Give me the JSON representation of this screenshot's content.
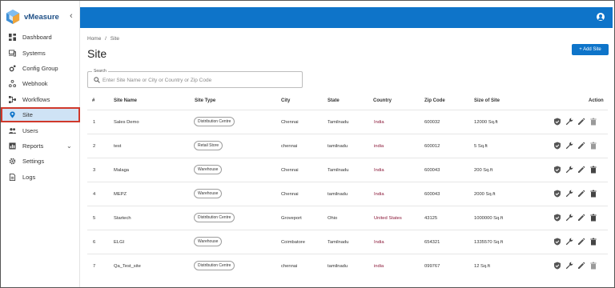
{
  "app": {
    "name": "vMeasure"
  },
  "sidebar": {
    "items": [
      {
        "label": "Dashboard",
        "icon": "dashboard-icon"
      },
      {
        "label": "Systems",
        "icon": "systems-icon"
      },
      {
        "label": "Config Group",
        "icon": "config-group-icon"
      },
      {
        "label": "Webhook",
        "icon": "webhook-icon"
      },
      {
        "label": "Workflows",
        "icon": "workflows-icon"
      },
      {
        "label": "Site",
        "icon": "site-pin-icon",
        "active": true
      },
      {
        "label": "Users",
        "icon": "users-icon"
      },
      {
        "label": "Reports",
        "icon": "reports-icon",
        "expandable": true
      },
      {
        "label": "Settings",
        "icon": "settings-gear-icon"
      },
      {
        "label": "Logs",
        "icon": "logs-icon"
      }
    ]
  },
  "breadcrumb": {
    "home": "Home",
    "separator": "/",
    "current": "Site"
  },
  "page": {
    "title": "Site",
    "add_button": "+ Add Site"
  },
  "search": {
    "legend": "Search",
    "placeholder": "Enter Site Name or City or Country or Zip Code"
  },
  "table": {
    "headers": {
      "num": "#",
      "site_name": "Site Name",
      "site_type": "Site Type",
      "city": "City",
      "state": "State",
      "country": "Country",
      "zip": "Zip Code",
      "size": "Size of Site",
      "action": "Action"
    },
    "rows": [
      {
        "num": "1",
        "site_name": "Sales Demo",
        "site_type": "Distribution Centre",
        "city": "Chennai",
        "state": "Tamilnadu",
        "country": "India",
        "zip": "600032",
        "size": "12000 Sq.ft"
      },
      {
        "num": "2",
        "site_name": "test",
        "site_type": "Retail Store",
        "city": "chennai",
        "state": "tamilnadu",
        "country": "india",
        "zip": "600012",
        "size": "5 Sq.ft"
      },
      {
        "num": "3",
        "site_name": "Malaga",
        "site_type": "Warehouse",
        "city": "Chennai",
        "state": "Tamilnadu",
        "country": "India",
        "zip": "600043",
        "size": "200 Sq.ft"
      },
      {
        "num": "4",
        "site_name": "MEPZ",
        "site_type": "Warehouse",
        "city": "Chennai",
        "state": "tamilnadu",
        "country": "India",
        "zip": "600043",
        "size": "2000 Sq.ft"
      },
      {
        "num": "5",
        "site_name": "Startech",
        "site_type": "Distribution Centre",
        "city": "Groveport",
        "state": "Ohio",
        "country": "United States",
        "zip": "43125",
        "size": "1000000 Sq.ft"
      },
      {
        "num": "6",
        "site_name": "ELGI",
        "site_type": "Warehouse",
        "city": "Coimbatore",
        "state": "Tamilnadu",
        "country": "India",
        "zip": "654321",
        "size": "1335570 Sq.ft"
      },
      {
        "num": "7",
        "site_name": "Qa_Test_site",
        "site_type": "Distribution Centre",
        "city": "chennai",
        "state": "tamilnadu",
        "country": "india",
        "zip": "099767",
        "size": "12 Sq.ft"
      }
    ]
  },
  "colors": {
    "primary": "#0e74c9",
    "active_bg": "#cfe3f5",
    "highlight": "#d0392b",
    "country_text": "#8b1a3a"
  }
}
